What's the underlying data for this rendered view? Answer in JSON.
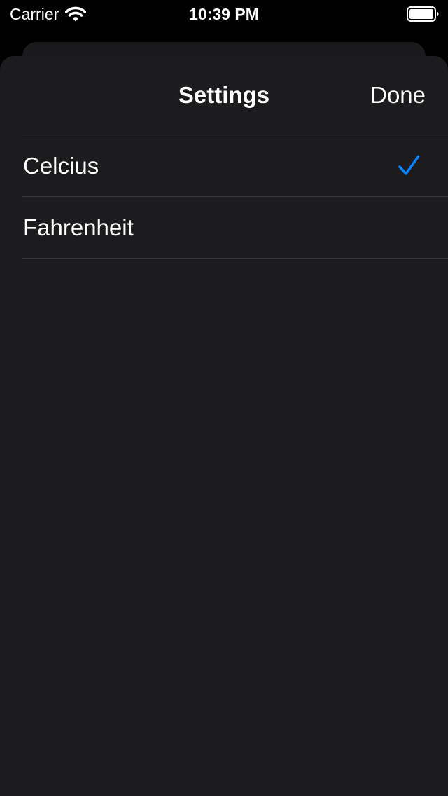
{
  "status_bar": {
    "carrier": "Carrier",
    "time": "10:39 PM",
    "wifi_icon": "wifi-icon",
    "battery_icon": "battery-full-icon"
  },
  "nav": {
    "title": "Settings",
    "done_label": "Done"
  },
  "options": [
    {
      "label": "Celcius",
      "selected": true
    },
    {
      "label": "Fahrenheit",
      "selected": false
    }
  ],
  "colors": {
    "background": "#000000",
    "sheet": "#1c1c1e",
    "separator": "#38383a",
    "text": "#ffffff",
    "accent": "#0a84ff"
  },
  "icons": {
    "selected_indicator": "checkmark-icon"
  }
}
